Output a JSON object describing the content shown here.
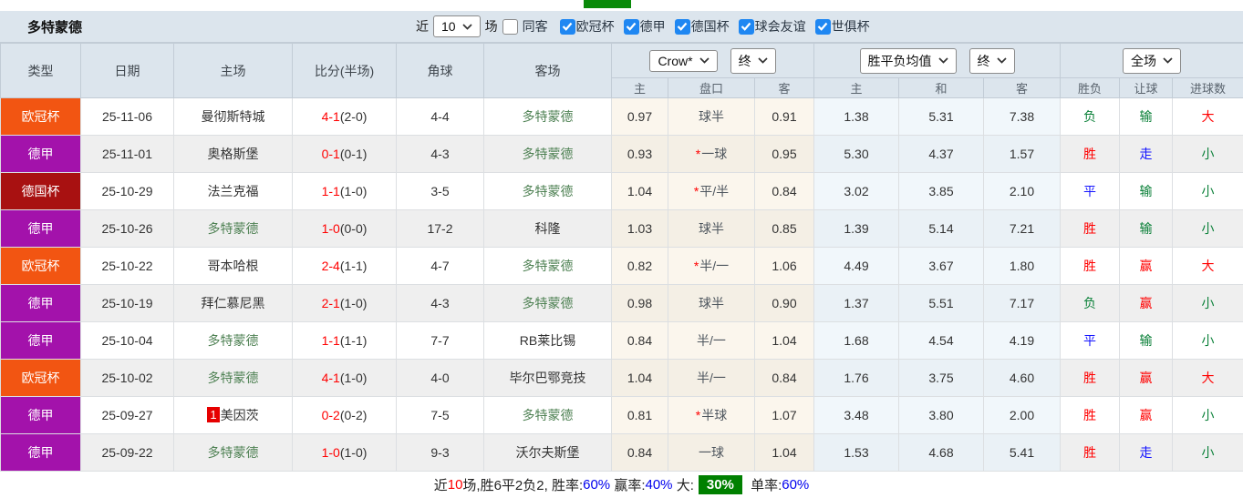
{
  "top": {
    "title": "多特蒙德",
    "near_label": "近",
    "near_value": "10",
    "games_label": "场",
    "same_away_label": "同客",
    "same_away_checked": false,
    "competitions": [
      {
        "label": "欧冠杯",
        "checked": true
      },
      {
        "label": "德甲",
        "checked": true
      },
      {
        "label": "德国杯",
        "checked": true
      },
      {
        "label": "球会友谊",
        "checked": true
      },
      {
        "label": "世俱杯",
        "checked": true
      }
    ]
  },
  "header": {
    "cols": [
      "类型",
      "日期",
      "主场",
      "比分(半场)",
      "角球",
      "客场"
    ],
    "selects": {
      "bookmaker": "Crow*",
      "bookmaker_time": "终",
      "avg": "胜平负均值",
      "avg_time": "终",
      "scope": "全场"
    },
    "sub": [
      "主",
      "盘口",
      "客",
      "主",
      "和",
      "客",
      "胜负",
      "让球",
      "进球数"
    ]
  },
  "rows": [
    {
      "type": {
        "label": "欧冠杯",
        "color": "#f25512"
      },
      "date": "25-11-06",
      "home": {
        "name": "曼彻斯特城",
        "self": false
      },
      "away": {
        "name": "多特蒙德",
        "self": true
      },
      "score_ft": "4-1",
      "score_ht": "(2-0)",
      "corners": "4-4",
      "ah_home": "0.97",
      "ah_star": false,
      "ah_line": "球半",
      "ah_away": "0.91",
      "o_home": "1.38",
      "o_draw": "5.31",
      "o_away": "7.38",
      "res_wdl": {
        "t": "负",
        "c": "green"
      },
      "res_ah": {
        "t": "输",
        "c": "green"
      },
      "res_ou": {
        "t": "大",
        "c": "red"
      }
    },
    {
      "type": {
        "label": "德甲",
        "color": "#a312ab"
      },
      "date": "25-11-01",
      "home": {
        "name": "奥格斯堡",
        "self": false
      },
      "away": {
        "name": "多特蒙德",
        "self": true
      },
      "score_ft": "0-1",
      "score_ht": "(0-1)",
      "corners": "4-3",
      "ah_home": "0.93",
      "ah_star": true,
      "ah_line": "一球",
      "ah_away": "0.95",
      "o_home": "5.30",
      "o_draw": "4.37",
      "o_away": "1.57",
      "res_wdl": {
        "t": "胜",
        "c": "red"
      },
      "res_ah": {
        "t": "走",
        "c": "blue"
      },
      "res_ou": {
        "t": "小",
        "c": "green"
      }
    },
    {
      "type": {
        "label": "德国杯",
        "color": "#a81111"
      },
      "date": "25-10-29",
      "home": {
        "name": "法兰克福",
        "self": false
      },
      "away": {
        "name": "多特蒙德",
        "self": true
      },
      "score_ft": "1-1",
      "score_ht": "(1-0)",
      "corners": "3-5",
      "ah_home": "1.04",
      "ah_star": true,
      "ah_line": "平/半",
      "ah_away": "0.84",
      "o_home": "3.02",
      "o_draw": "3.85",
      "o_away": "2.10",
      "res_wdl": {
        "t": "平",
        "c": "blue"
      },
      "res_ah": {
        "t": "输",
        "c": "green"
      },
      "res_ou": {
        "t": "小",
        "c": "green"
      }
    },
    {
      "type": {
        "label": "德甲",
        "color": "#a312ab"
      },
      "date": "25-10-26",
      "home": {
        "name": "多特蒙德",
        "self": true
      },
      "away": {
        "name": "科隆",
        "self": false
      },
      "score_ft": "1-0",
      "score_ht": "(0-0)",
      "corners": "17-2",
      "ah_home": "1.03",
      "ah_star": false,
      "ah_line": "球半",
      "ah_away": "0.85",
      "o_home": "1.39",
      "o_draw": "5.14",
      "o_away": "7.21",
      "res_wdl": {
        "t": "胜",
        "c": "red"
      },
      "res_ah": {
        "t": "输",
        "c": "green"
      },
      "res_ou": {
        "t": "小",
        "c": "green"
      }
    },
    {
      "type": {
        "label": "欧冠杯",
        "color": "#f25512"
      },
      "date": "25-10-22",
      "home": {
        "name": "哥本哈根",
        "self": false
      },
      "away": {
        "name": "多特蒙德",
        "self": true
      },
      "score_ft": "2-4",
      "score_ht": "(1-1)",
      "corners": "4-7",
      "ah_home": "0.82",
      "ah_star": true,
      "ah_line": "半/一",
      "ah_away": "1.06",
      "o_home": "4.49",
      "o_draw": "3.67",
      "o_away": "1.80",
      "res_wdl": {
        "t": "胜",
        "c": "red"
      },
      "res_ah": {
        "t": "赢",
        "c": "red"
      },
      "res_ou": {
        "t": "大",
        "c": "red"
      }
    },
    {
      "type": {
        "label": "德甲",
        "color": "#a312ab"
      },
      "date": "25-10-19",
      "home": {
        "name": "拜仁慕尼黑",
        "self": false
      },
      "away": {
        "name": "多特蒙德",
        "self": true
      },
      "score_ft": "2-1",
      "score_ht": "(1-0)",
      "corners": "4-3",
      "ah_home": "0.98",
      "ah_star": false,
      "ah_line": "球半",
      "ah_away": "0.90",
      "o_home": "1.37",
      "o_draw": "5.51",
      "o_away": "7.17",
      "res_wdl": {
        "t": "负",
        "c": "green"
      },
      "res_ah": {
        "t": "赢",
        "c": "red"
      },
      "res_ou": {
        "t": "小",
        "c": "green"
      }
    },
    {
      "type": {
        "label": "德甲",
        "color": "#a312ab"
      },
      "date": "25-10-04",
      "home": {
        "name": "多特蒙德",
        "self": true
      },
      "away": {
        "name": "RB莱比锡",
        "self": false
      },
      "score_ft": "1-1",
      "score_ht": "(1-1)",
      "corners": "7-7",
      "ah_home": "0.84",
      "ah_star": false,
      "ah_line": "半/一",
      "ah_away": "1.04",
      "o_home": "1.68",
      "o_draw": "4.54",
      "o_away": "4.19",
      "res_wdl": {
        "t": "平",
        "c": "blue"
      },
      "res_ah": {
        "t": "输",
        "c": "green"
      },
      "res_ou": {
        "t": "小",
        "c": "green"
      }
    },
    {
      "type": {
        "label": "欧冠杯",
        "color": "#f25512"
      },
      "date": "25-10-02",
      "home": {
        "name": "多特蒙德",
        "self": true
      },
      "away": {
        "name": "毕尔巴鄂竞技",
        "self": false
      },
      "score_ft": "4-1",
      "score_ht": "(1-0)",
      "corners": "4-0",
      "ah_home": "1.04",
      "ah_star": false,
      "ah_line": "半/一",
      "ah_away": "0.84",
      "o_home": "1.76",
      "o_draw": "3.75",
      "o_away": "4.60",
      "res_wdl": {
        "t": "胜",
        "c": "red"
      },
      "res_ah": {
        "t": "赢",
        "c": "red"
      },
      "res_ou": {
        "t": "大",
        "c": "red"
      }
    },
    {
      "type": {
        "label": "德甲",
        "color": "#a312ab"
      },
      "date": "25-09-27",
      "home": {
        "name": "美因茨",
        "self": false,
        "rank": "1"
      },
      "away": {
        "name": "多特蒙德",
        "self": true
      },
      "score_ft": "0-2",
      "score_ht": "(0-2)",
      "corners": "7-5",
      "ah_home": "0.81",
      "ah_star": true,
      "ah_line": "半球",
      "ah_away": "1.07",
      "o_home": "3.48",
      "o_draw": "3.80",
      "o_away": "2.00",
      "res_wdl": {
        "t": "胜",
        "c": "red"
      },
      "res_ah": {
        "t": "赢",
        "c": "red"
      },
      "res_ou": {
        "t": "小",
        "c": "green"
      }
    },
    {
      "type": {
        "label": "德甲",
        "color": "#a312ab"
      },
      "date": "25-09-22",
      "home": {
        "name": "多特蒙德",
        "self": true
      },
      "away": {
        "name": "沃尔夫斯堡",
        "self": false
      },
      "score_ft": "1-0",
      "score_ht": "(1-0)",
      "corners": "9-3",
      "ah_home": "0.84",
      "ah_star": false,
      "ah_line": "一球",
      "ah_away": "1.04",
      "o_home": "1.53",
      "o_draw": "4.68",
      "o_away": "5.41",
      "res_wdl": {
        "t": "胜",
        "c": "red"
      },
      "res_ah": {
        "t": "走",
        "c": "blue"
      },
      "res_ou": {
        "t": "小",
        "c": "green"
      }
    }
  ],
  "footer": {
    "prefix": "近",
    "count": "10",
    "summary": "场,胜6平2负2, 胜率:",
    "win_rate": "60%",
    "ah_label": " 赢率:",
    "ah_rate": "40%",
    "big_label": " 大:",
    "big_rate": "30%",
    "odd_label": " 单率:",
    "odd_rate": "60%"
  },
  "colors": {
    "accent_blue_checkbox": "#1f87f2",
    "badge_green": "#008000",
    "self_team_green": "#4e8153",
    "score_red": "#ff0000",
    "ucl_orange": "#f25512",
    "bundesliga_purple": "#a312ab",
    "dfb_darkred": "#a81111"
  }
}
